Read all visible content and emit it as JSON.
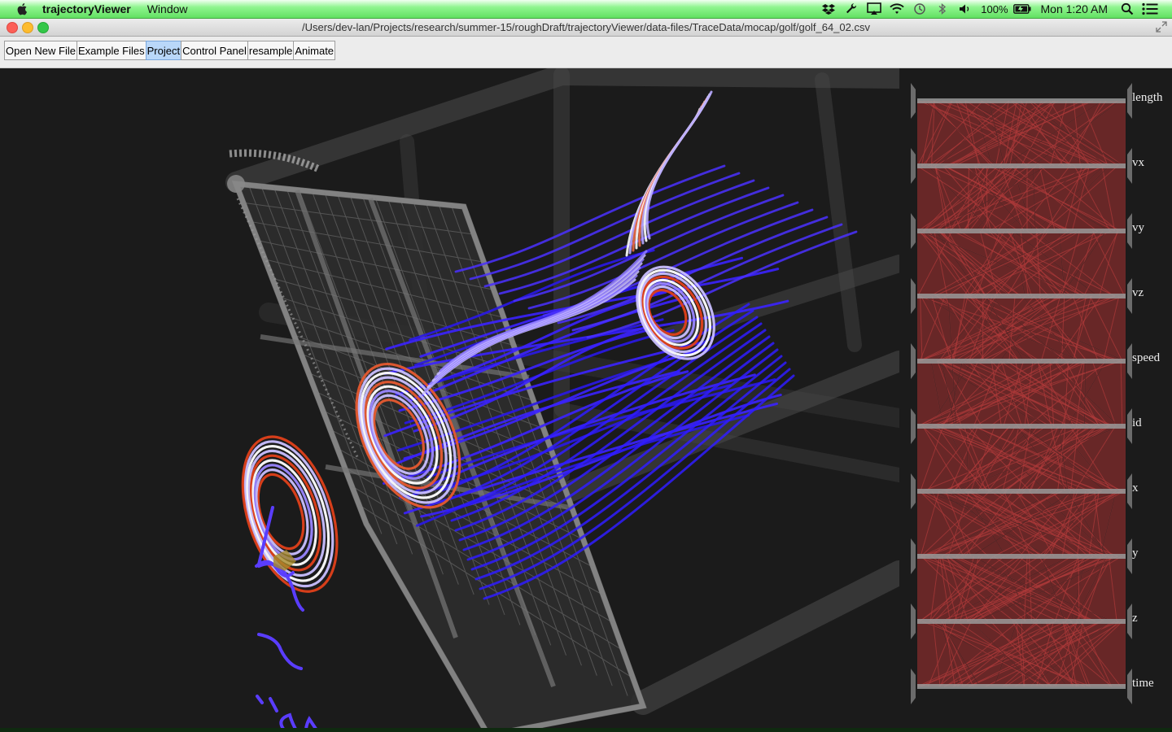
{
  "menubar": {
    "app_name": "trajectoryViewer",
    "menus": [
      "Window"
    ],
    "battery": "100%",
    "clock": "Mon 1:20 AM"
  },
  "window": {
    "title": "/Users/dev-lan/Projects/research/summer-15/roughDraft/trajectoryViewer/data-files/TraceData/mocap/golf/golf_64_02.csv"
  },
  "toolbar": {
    "buttons": [
      "Open New File",
      "Example Files",
      "Project",
      "Control Panel",
      "resample",
      "Animate"
    ],
    "active": "Project"
  },
  "parallel_coordinates": {
    "axes": [
      "length",
      "vx",
      "vy",
      "vz",
      "speed",
      "id",
      "x",
      "y",
      "z",
      "time"
    ],
    "line_color": "#a83232"
  },
  "colors": {
    "trajectory_low": "#3a1aff",
    "trajectory_mid": "#e8e2ff",
    "trajectory_high": "#e0401a",
    "background": "#1b1b1b"
  }
}
